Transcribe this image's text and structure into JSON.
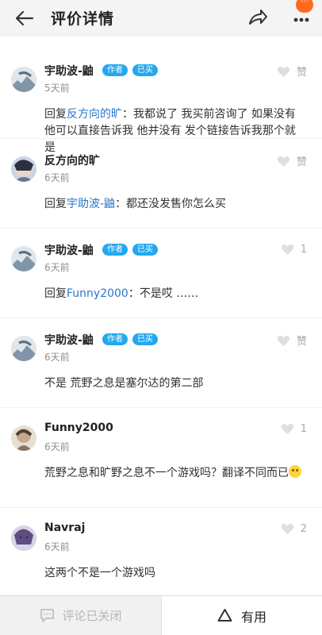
{
  "header": {
    "title": "评价详情",
    "more_badge": "···"
  },
  "footer": {
    "closed_label": "评论已关闭",
    "useful_label": "有用"
  },
  "comments": [
    {
      "username": "宇助波-鼬",
      "badges": [
        "作者",
        "已买"
      ],
      "time": "5天前",
      "like": "赞",
      "reply_prefix": "回复",
      "reply_to": "反方向的旷",
      "text": "：我都说了 我买前咨询了 如果没有他可以直接告诉我 他并没有 发个链接告诉我那个就是"
    },
    {
      "username": "反方向的旷",
      "badges": [],
      "time": "6天前",
      "like": "赞",
      "reply_prefix": "回复",
      "reply_to": "宇助波-鼬",
      "text": "：都还没发售你怎么买"
    },
    {
      "username": "宇助波-鼬",
      "badges": [
        "作者",
        "已买"
      ],
      "time": "6天前",
      "like": "1",
      "reply_prefix": "回复",
      "reply_to": "Funny2000",
      "text": "：不是哎 ……"
    },
    {
      "username": "宇助波-鼬",
      "badges": [
        "作者",
        "已买"
      ],
      "time": "6天前",
      "like": "赞",
      "text": "不是 荒野之息是塞尔达的第二部"
    },
    {
      "username": "Funny2000",
      "badges": [],
      "time": "6天前",
      "like": "1",
      "text": "荒野之息和旷野之息不一个游戏吗？翻译不同而已"
    },
    {
      "username": "Navraj",
      "badges": [],
      "time": "6天前",
      "like": "2",
      "text": "这两个不是一个游戏吗"
    }
  ],
  "colors": {
    "badge": "#23a8ee",
    "reply_link": "#2a78c8",
    "notification": "#ff6a21"
  },
  "icons": {
    "back": "back-arrow-icon",
    "share": "share-icon",
    "more": "more-icon",
    "like": "heart-icon",
    "comment": "comment-icon",
    "useful": "triangle-icon"
  }
}
